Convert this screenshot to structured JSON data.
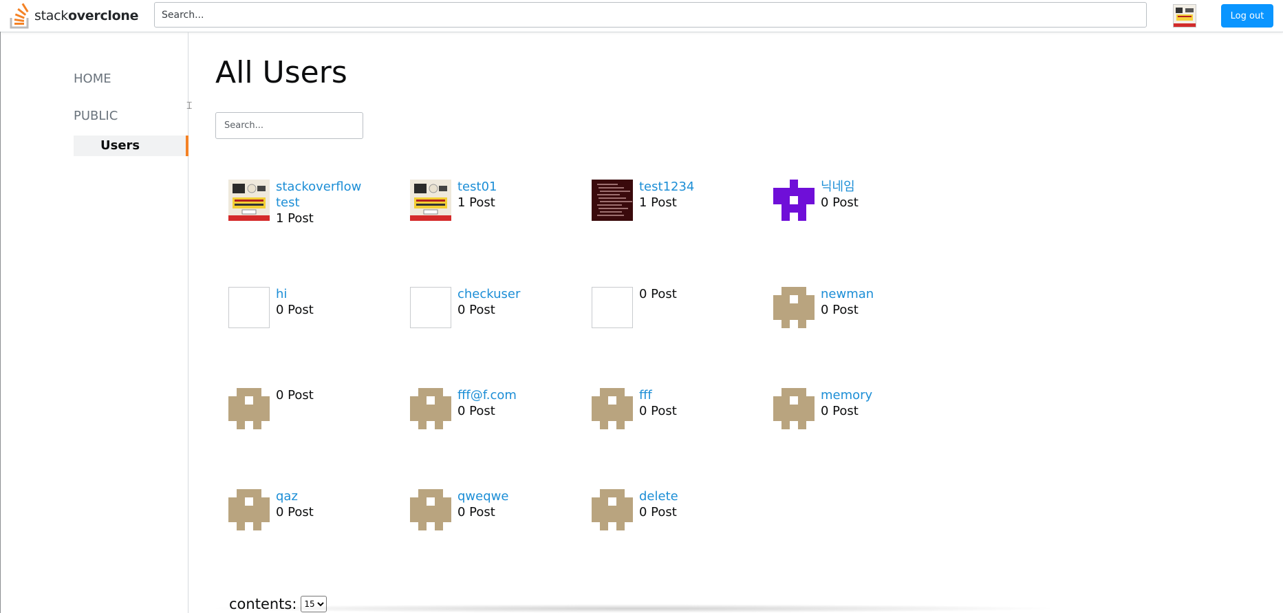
{
  "brand": {
    "prefix": "stack",
    "name": "overclone",
    "accent": "#f48225"
  },
  "header": {
    "search_placeholder": "Search...",
    "logout_label": "Log out",
    "logout_color": "#0a95ff"
  },
  "sidebar": {
    "home": "HOME",
    "public": "PUBLIC",
    "users": "Users"
  },
  "main": {
    "title": "All Users",
    "search_placeholder": "Search...",
    "contents_label": "contents:",
    "page_size": "15"
  },
  "users": [
    {
      "name": "stackoverflow test",
      "posts": "1 Post",
      "avatar": "thumbnail-image"
    },
    {
      "name": "test01",
      "posts": "1 Post",
      "avatar": "thumbnail-image"
    },
    {
      "name": "test1234",
      "posts": "1 Post",
      "avatar": "dark-text-image"
    },
    {
      "name": "닉네임",
      "posts": "0 Post",
      "avatar": "identicon-purple"
    },
    {
      "name": "hi",
      "posts": "0 Post",
      "avatar": "blank"
    },
    {
      "name": "checkuser",
      "posts": "0 Post",
      "avatar": "blank"
    },
    {
      "name": "",
      "posts": "0 Post",
      "avatar": "blank"
    },
    {
      "name": "newman",
      "posts": "0 Post",
      "avatar": "identicon-tan"
    },
    {
      "name": "",
      "posts": "0 Post",
      "avatar": "identicon-tan"
    },
    {
      "name": "fff@f.com",
      "posts": "0 Post",
      "avatar": "identicon-tan"
    },
    {
      "name": "fff",
      "posts": "0 Post",
      "avatar": "identicon-tan"
    },
    {
      "name": "memory",
      "posts": "0 Post",
      "avatar": "identicon-tan"
    },
    {
      "name": "qaz",
      "posts": "0 Post",
      "avatar": "identicon-tan"
    },
    {
      "name": "qweqwe",
      "posts": "0 Post",
      "avatar": "identicon-tan"
    },
    {
      "name": "delete",
      "posts": "0 Post",
      "avatar": "identicon-tan"
    }
  ],
  "colors": {
    "link": "#1c8ed6",
    "identicon_tan": "#b9a47f",
    "identicon_purple": "#6f0fd8"
  }
}
